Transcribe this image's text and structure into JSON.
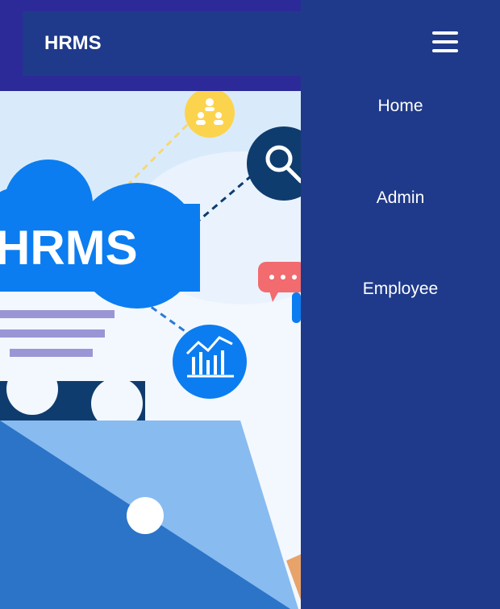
{
  "header": {
    "brand": "HRMS"
  },
  "hero": {
    "logo_text": "HRMS"
  },
  "drawer": {
    "items": [
      {
        "label": "Home"
      },
      {
        "label": "Admin"
      },
      {
        "label": "Employee"
      }
    ]
  },
  "colors": {
    "drawer_bg": "#1f3a8a",
    "top_band": "#2c2a98",
    "cloud_blue": "#0b7df0",
    "dark_navy": "#0f3c6e",
    "accent_yellow": "#fcd34d",
    "accent_red": "#f16b6f",
    "text_white": "#ffffff"
  }
}
